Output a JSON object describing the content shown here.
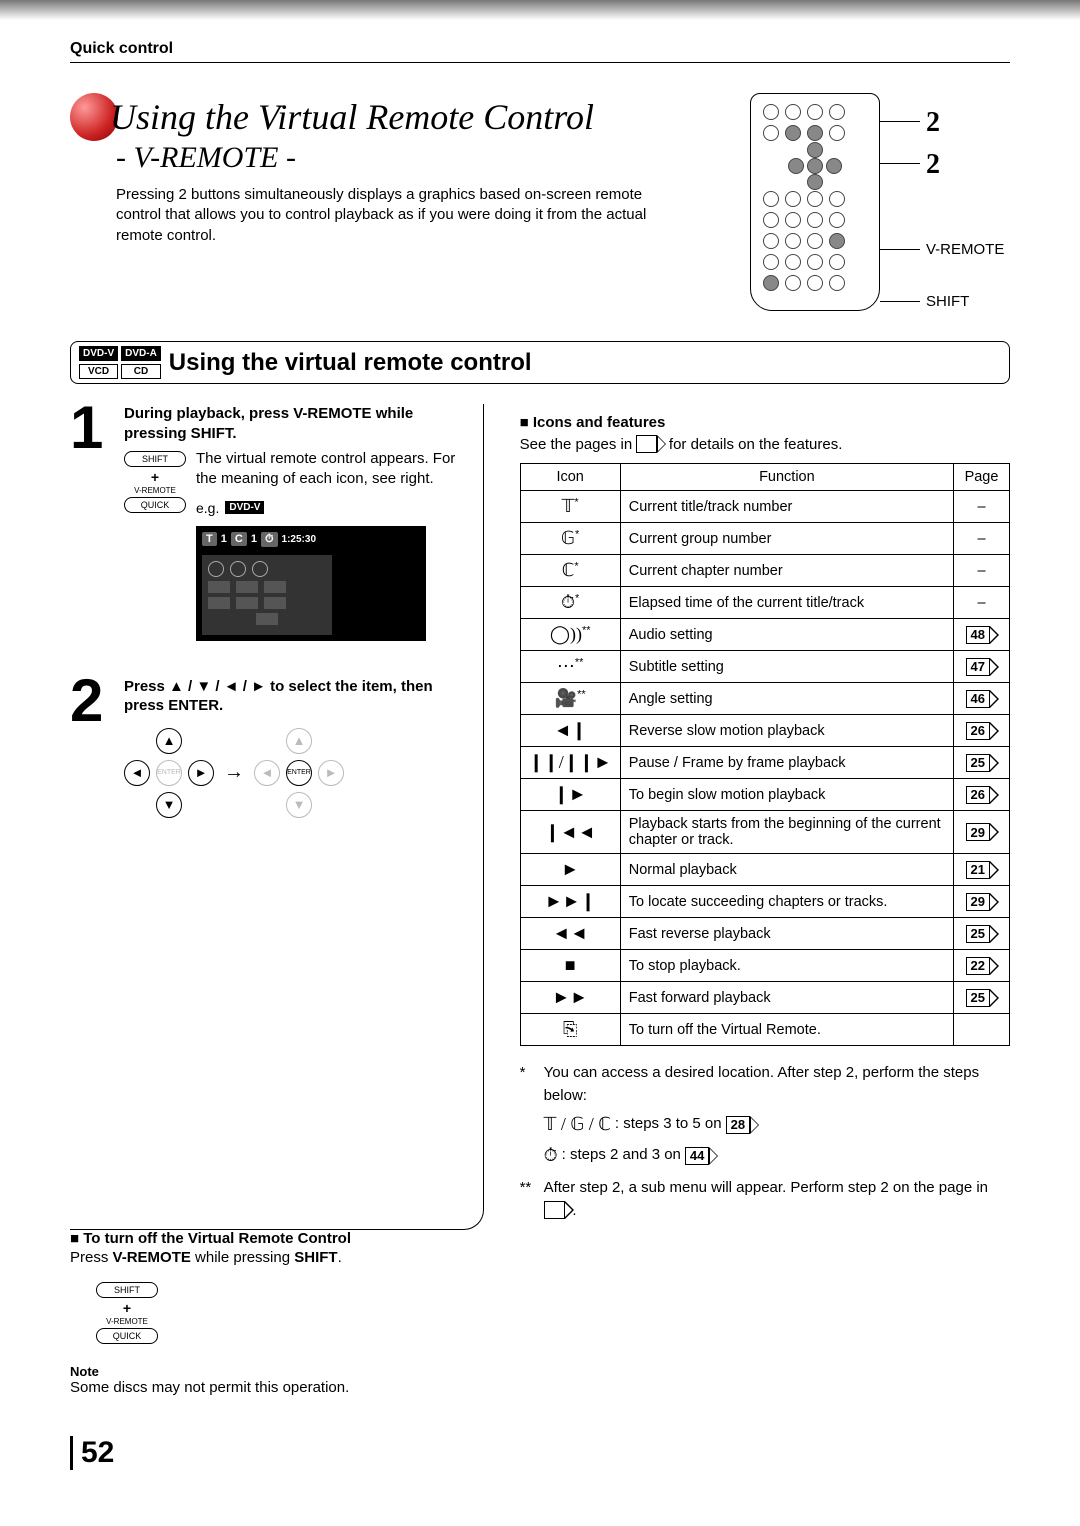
{
  "header": {
    "breadcrumb": "Quick control",
    "title": "Using the Virtual Remote Control",
    "subtitle": "- V-REMOTE -",
    "intro": "Pressing 2 buttons simultaneously displays a graphics based on-screen remote control that allows you to control playback as if you were doing it from the actual remote control.",
    "callout_vremote": "V-REMOTE",
    "callout_shift": "SHIFT",
    "callout_num": "2"
  },
  "section": {
    "title": "Using the virtual remote control",
    "badges": [
      "DVD-V",
      "DVD-A",
      "VCD",
      "CD"
    ]
  },
  "steps": {
    "s1": {
      "num": "1",
      "title": "During playback, press V-REMOTE while pressing SHIFT.",
      "desc": "The virtual remote control appears. For the meaning of each icon, see right.",
      "side_shift": "SHIFT",
      "side_plus": "+",
      "side_vremote": "V-REMOTE",
      "side_quick": "QUICK",
      "eg": "e.g.",
      "eg_badge": "DVD-V",
      "osd_t": "T",
      "osd_t_val": "1",
      "osd_c": "C",
      "osd_c_val": "1",
      "osd_clock": "⏱",
      "osd_time": "1:25:30"
    },
    "s2": {
      "num": "2",
      "title": "Press ▲ / ▼ / ◄ / ► to select the item, then press ENTER.",
      "enter": "ENTER"
    }
  },
  "turnoff": {
    "head": "To turn off the Virtual Remote Control",
    "text_pre": "Press ",
    "text_b1": "V-REMOTE",
    "text_mid": " while pressing ",
    "text_b2": "SHIFT",
    "text_post": ".",
    "side_shift": "SHIFT",
    "side_plus": "+",
    "side_vremote": "V-REMOTE",
    "side_quick": "QUICK"
  },
  "note": {
    "label": "Note",
    "text": "Some discs may not permit this operation."
  },
  "features": {
    "head": "Icons and features",
    "see_pre": "See the pages in ",
    "see_post": " for details on the features.",
    "th_icon": "Icon",
    "th_func": "Function",
    "th_page": "Page",
    "rows": [
      {
        "icon": "𝕋",
        "sup": "*",
        "func": "Current title/track number",
        "page": "–"
      },
      {
        "icon": "𝔾",
        "sup": "*",
        "func": "Current group number",
        "page": "–"
      },
      {
        "icon": "ℂ",
        "sup": "*",
        "func": "Current chapter number",
        "page": "–"
      },
      {
        "icon": "⏱",
        "sup": "*",
        "func": "Elapsed time of the current title/track",
        "page": "–"
      },
      {
        "icon": "◯))",
        "sup": "**",
        "func": "Audio setting",
        "page": "48"
      },
      {
        "icon": "⋯",
        "sup": "**",
        "func": "Subtitle setting",
        "page": "47"
      },
      {
        "icon": "🎥",
        "sup": "**",
        "func": "Angle setting",
        "page": "46"
      },
      {
        "icon": "◄❙",
        "sup": "",
        "func": "Reverse slow motion playback",
        "page": "26"
      },
      {
        "icon": "❙❙/❙❙►",
        "sup": "",
        "func": "Pause / Frame by frame playback",
        "page": "25"
      },
      {
        "icon": "❙►",
        "sup": "",
        "func": "To begin slow motion playback",
        "page": "26"
      },
      {
        "icon": "❙◄◄",
        "sup": "",
        "func": "Playback starts from the beginning of the current chapter or track.",
        "page": "29"
      },
      {
        "icon": "►",
        "sup": "",
        "func": "Normal playback",
        "page": "21"
      },
      {
        "icon": "►►❙",
        "sup": "",
        "func": "To locate succeeding chapters or tracks.",
        "page": "29"
      },
      {
        "icon": "◄◄",
        "sup": "",
        "func": "Fast reverse playback",
        "page": "25"
      },
      {
        "icon": "■",
        "sup": "",
        "func": "To stop playback.",
        "page": "22"
      },
      {
        "icon": "►►",
        "sup": "",
        "func": "Fast forward playback",
        "page": "25"
      },
      {
        "icon": "⎘",
        "sup": "",
        "func": "To turn off the Virtual Remote.",
        "page": ""
      }
    ]
  },
  "footnotes": {
    "f1_marker": "*",
    "f1_text": "You can access a desired location. After step 2, perform the steps below:",
    "f1_sub1_icons": "𝕋 / 𝔾 / ℂ",
    "f1_sub1_text": ": steps 3 to 5 on",
    "f1_sub1_page": "28",
    "f1_sub2_icon": "⏱",
    "f1_sub2_text": ": steps 2 and 3 on",
    "f1_sub2_page": "44",
    "f2_marker": "**",
    "f2_text": "After step 2, a sub menu will appear. Perform step 2 on the page in "
  },
  "page_number": "52"
}
